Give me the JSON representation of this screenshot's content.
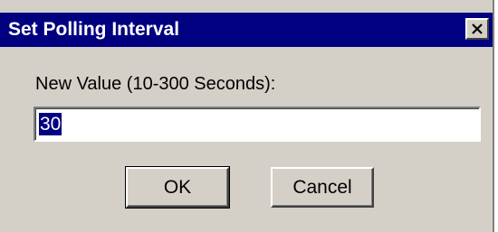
{
  "dialog": {
    "title": "Set Polling Interval",
    "close_icon": "close-icon",
    "prompt": "New Value (10-300 Seconds):",
    "value": "30",
    "ok_label": "OK",
    "cancel_label": "Cancel"
  },
  "colors": {
    "titlebar": "#000080",
    "face": "#d4d0c8",
    "selection": "#000080"
  }
}
